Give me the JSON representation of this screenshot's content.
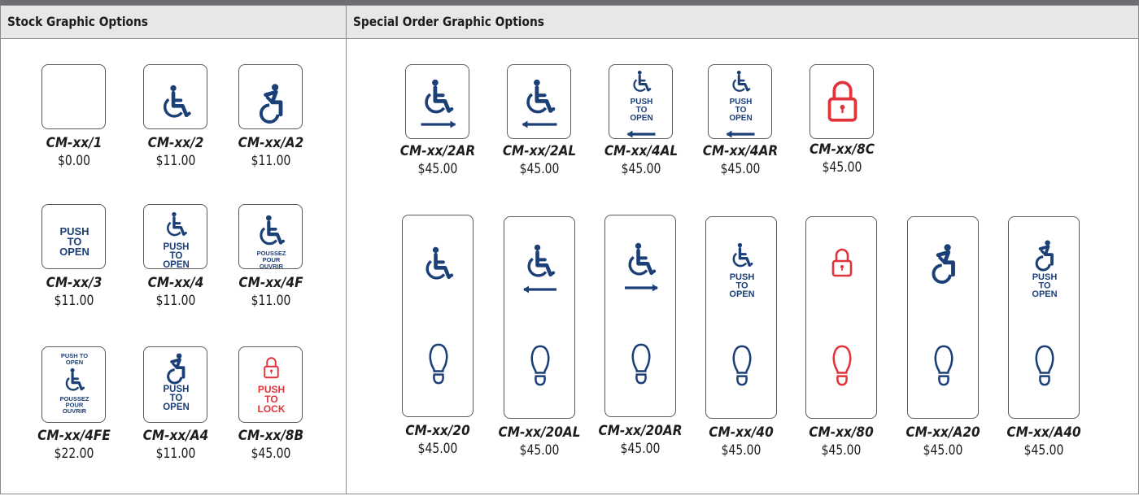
{
  "panels": {
    "stock_title": "Stock Graphic Options",
    "special_title": "Special Order Graphic Options"
  },
  "colors": {
    "blue": "#1b3f77",
    "red": "#e0343a",
    "header_bg": "#e6e7e8"
  },
  "stock": [
    {
      "model": "CM-xx/1",
      "price": "$0.00",
      "graphic": "blank"
    },
    {
      "model": "CM-xx/2",
      "price": "$11.00",
      "graphic": "wheelchair-icon"
    },
    {
      "model": "CM-xx/A2",
      "price": "$11.00",
      "graphic": "active-wheelchair-icon"
    },
    {
      "model": "CM-xx/3",
      "price": "$11.00",
      "graphic": "push-to-open-text",
      "lines": [
        "PUSH",
        "TO",
        "OPEN"
      ]
    },
    {
      "model": "CM-xx/4",
      "price": "$11.00",
      "graphic": "wheelchair-icon",
      "lines": [
        "PUSH",
        "TO",
        "OPEN"
      ]
    },
    {
      "model": "CM-xx/4F",
      "price": "$11.00",
      "graphic": "wheelchair-icon",
      "lines": [
        "POUSSEZ",
        "POUR",
        "OUVRIR"
      ]
    },
    {
      "model": "CM-xx/4FE",
      "price": "$22.00",
      "graphic": "wheelchair-icon",
      "top_lines": [
        "PUSH TO",
        "OPEN"
      ],
      "lines": [
        "POUSSEZ",
        "POUR",
        "OUVRIR"
      ]
    },
    {
      "model": "CM-xx/A4",
      "price": "$11.00",
      "graphic": "active-wheelchair-icon",
      "lines": [
        "PUSH",
        "TO",
        "OPEN"
      ]
    },
    {
      "model": "CM-xx/8B",
      "price": "$45.00",
      "graphic": "padlock-icon",
      "lines": [
        "PUSH",
        "TO",
        "LOCK"
      ]
    }
  ],
  "special_small": [
    {
      "model": "CM-xx/2AR",
      "price": "$45.00",
      "graphic": "wheelchair-icon",
      "arrow": "right"
    },
    {
      "model": "CM-xx/2AL",
      "price": "$45.00",
      "graphic": "wheelchair-icon",
      "arrow": "left"
    },
    {
      "model": "CM-xx/4AL",
      "price": "$45.00",
      "graphic": "wheelchair-icon",
      "lines": [
        "PUSH",
        "TO",
        "OPEN"
      ],
      "arrow": "left"
    },
    {
      "model": "CM-xx/4AR",
      "price": "$45.00",
      "graphic": "wheelchair-icon",
      "lines": [
        "PUSH",
        "TO",
        "OPEN"
      ],
      "arrow": "left"
    },
    {
      "model": "CM-xx/8C",
      "price": "$45.00",
      "graphic": "padlock-icon"
    }
  ],
  "special_tall": [
    {
      "model": "CM-xx/20",
      "price": "$45.00",
      "graphic": "wheelchair-icon",
      "foot": "footprint-icon"
    },
    {
      "model": "CM-xx/20AL",
      "price": "$45.00",
      "graphic": "wheelchair-icon",
      "arrow": "left",
      "foot": "footprint-icon"
    },
    {
      "model": "CM-xx/20AR",
      "price": "$45.00",
      "graphic": "wheelchair-icon",
      "arrow": "right",
      "foot": "footprint-icon"
    },
    {
      "model": "CM-xx/40",
      "price": "$45.00",
      "graphic": "wheelchair-icon",
      "lines": [
        "PUSH",
        "TO",
        "OPEN"
      ],
      "foot": "footprint-icon"
    },
    {
      "model": "CM-xx/80",
      "price": "$45.00",
      "graphic": "padlock-icon",
      "foot": "footprint-icon"
    },
    {
      "model": "CM-xx/A20",
      "price": "$45.00",
      "graphic": "active-wheelchair-icon",
      "foot": "footprint-icon"
    },
    {
      "model": "CM-xx/A40",
      "price": "$45.00",
      "graphic": "active-wheelchair-icon",
      "lines": [
        "PUSH",
        "TO",
        "OPEN"
      ],
      "foot": "footprint-icon"
    }
  ]
}
